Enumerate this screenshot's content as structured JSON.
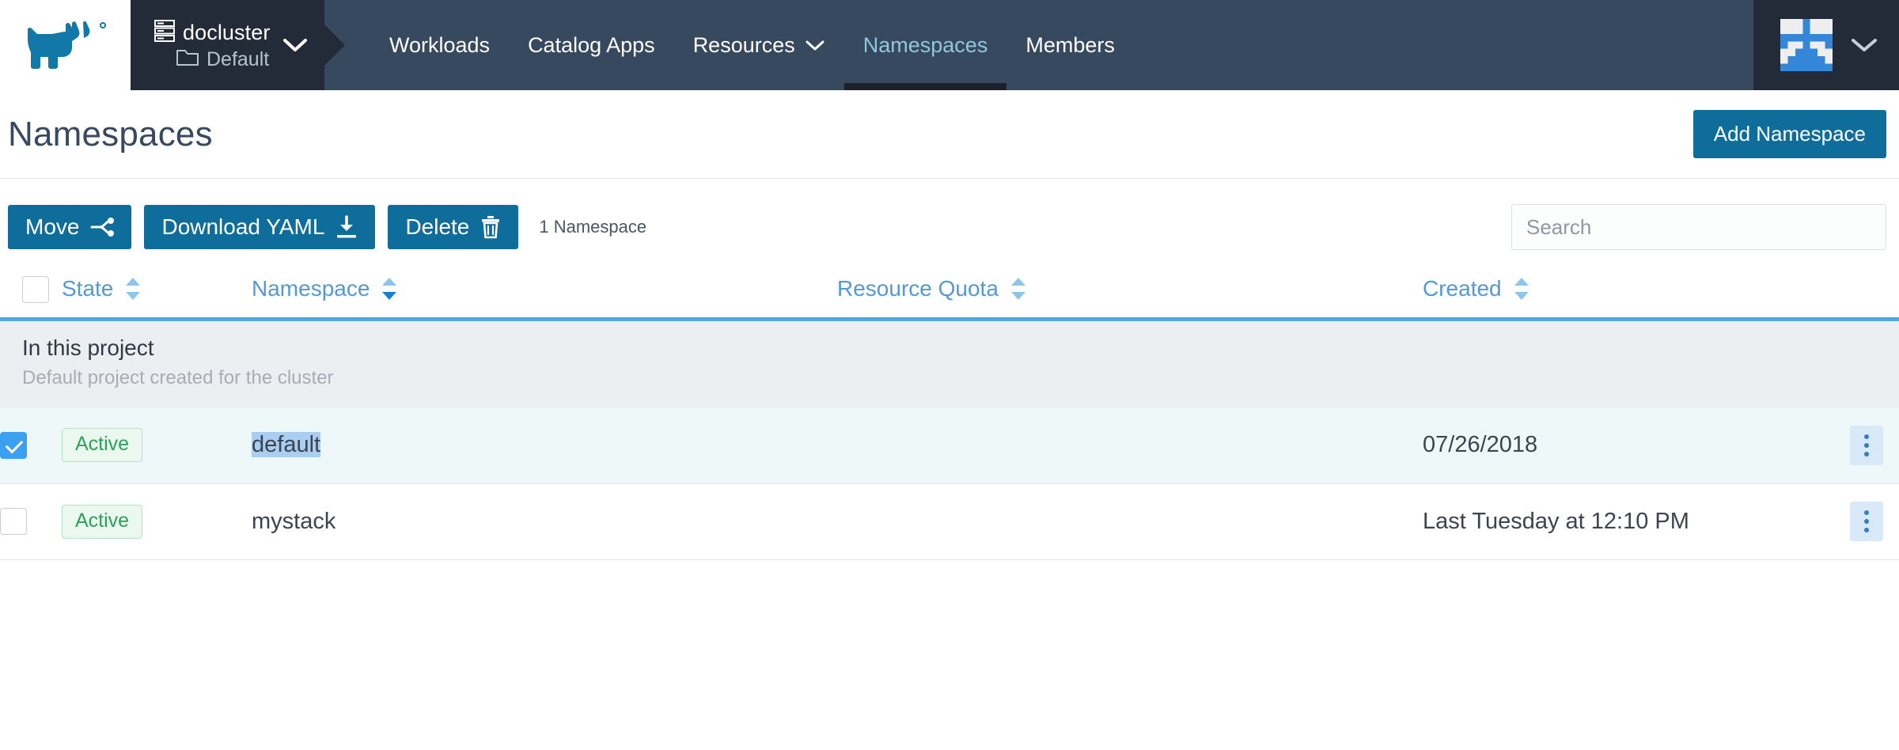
{
  "header": {
    "logo_icon": "rancher-cow-logo",
    "cluster": {
      "icon": "server-stack-icon",
      "name": "docluster",
      "project_icon": "folder-icon",
      "project": "Default",
      "caret_icon": "chevron-down-icon"
    },
    "nav": [
      {
        "label": "Workloads",
        "active": false,
        "has_caret": false,
        "icon": ""
      },
      {
        "label": "Catalog Apps",
        "active": false,
        "has_caret": false,
        "icon": ""
      },
      {
        "label": "Resources",
        "active": false,
        "has_caret": true,
        "icon": "chevron-down-icon"
      },
      {
        "label": "Namespaces",
        "active": true,
        "has_caret": false,
        "icon": ""
      },
      {
        "label": "Members",
        "active": false,
        "has_caret": false,
        "icon": ""
      }
    ],
    "user": {
      "avatar_icon": "user-identicon-avatar",
      "caret_icon": "chevron-down-icon"
    }
  },
  "page": {
    "title": "Namespaces",
    "add_button": "Add Namespace"
  },
  "toolbar": {
    "move_label": "Move",
    "move_icon": "move-branch-icon",
    "download_label": "Download YAML",
    "download_icon": "download-icon",
    "delete_label": "Delete",
    "delete_icon": "trash-icon",
    "count_label": "1 Namespace",
    "search_placeholder": "Search",
    "search_value": ""
  },
  "table": {
    "columns": [
      {
        "label": "State",
        "sortable": true,
        "sort": "none"
      },
      {
        "label": "Namespace",
        "sortable": true,
        "sort": "desc"
      },
      {
        "label": "Resource Quota",
        "sortable": true,
        "sort": "none"
      },
      {
        "label": "Created",
        "sortable": true,
        "sort": "none"
      }
    ],
    "select_all_checked": false,
    "group": {
      "title": "In this project",
      "subtitle": "Default project created for the cluster"
    },
    "rows": [
      {
        "checked": true,
        "state": "Active",
        "namespace": "default",
        "namespace_text_selected": true,
        "resource_quota": "",
        "created": "07/26/2018",
        "actions_icon": "vertical-dots-icon"
      },
      {
        "checked": false,
        "state": "Active",
        "namespace": "mystack",
        "namespace_text_selected": false,
        "resource_quota": "",
        "created": "Last Tuesday at 12:10 PM",
        "actions_icon": "vertical-dots-icon"
      }
    ]
  },
  "colors": {
    "header_bg": "#37495e",
    "header_dark": "#242b38",
    "primary": "#0f6d9b",
    "link": "#5499d5",
    "rule": "#4da7e0",
    "active_tab_text": "#8fc7dd",
    "badge_text": "#2ea05a",
    "badge_bg": "#eaf8ef",
    "row_selected_bg": "#eff8f9",
    "text_selection_bg": "#aacdf2"
  }
}
